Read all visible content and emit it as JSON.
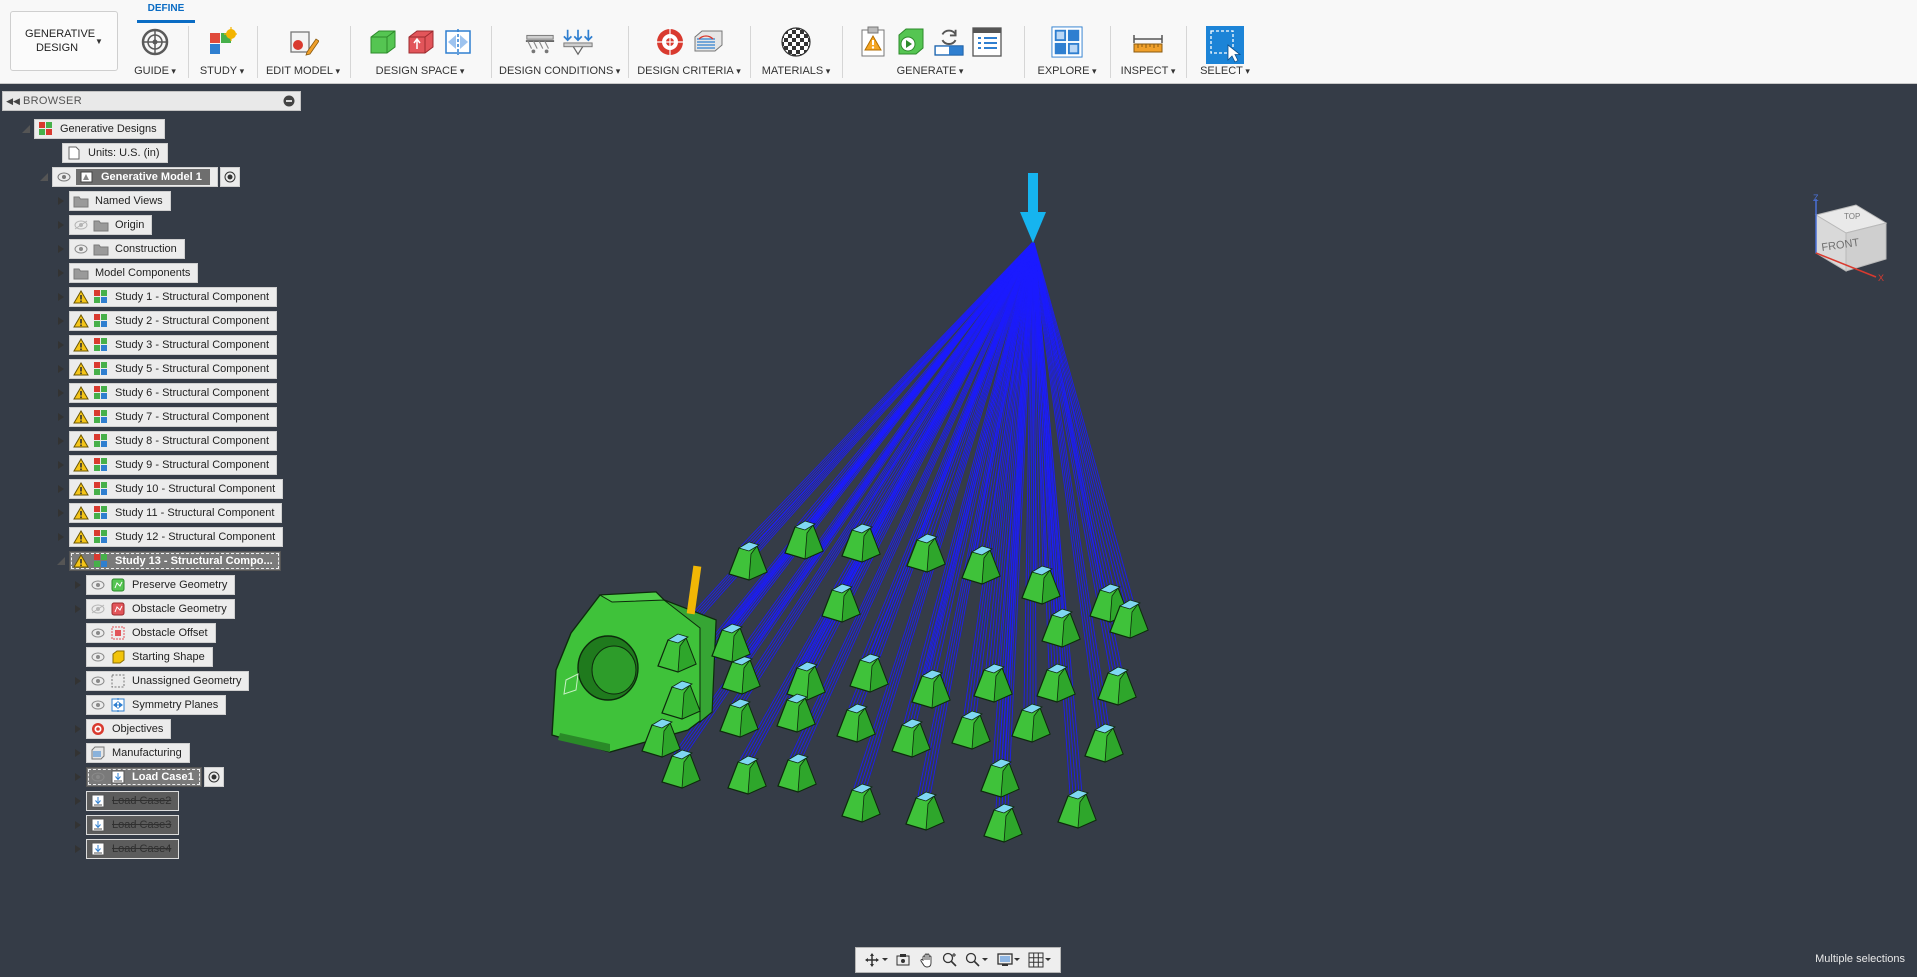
{
  "workspace": {
    "line1": "GENERATIVE",
    "line2": "DESIGN"
  },
  "active_tab": "DEFINE",
  "toolbar_groups": [
    {
      "id": "guide",
      "label": "GUIDE"
    },
    {
      "id": "study",
      "label": "STUDY"
    },
    {
      "id": "edit_model",
      "label": "EDIT MODEL"
    },
    {
      "id": "design_space",
      "label": "DESIGN SPACE"
    },
    {
      "id": "design_conditions",
      "label": "DESIGN CONDITIONS"
    },
    {
      "id": "design_criteria",
      "label": "DESIGN CRITERIA"
    },
    {
      "id": "materials",
      "label": "MATERIALS"
    },
    {
      "id": "generate",
      "label": "GENERATE"
    },
    {
      "id": "explore",
      "label": "EXPLORE"
    },
    {
      "id": "inspect",
      "label": "INSPECT"
    },
    {
      "id": "select",
      "label": "SELECT"
    }
  ],
  "browser": {
    "title": "BROWSER",
    "root": "Generative Designs",
    "units": "Units: U.S. (in)",
    "model": "Generative Model 1",
    "folders": [
      "Named Views",
      "Origin",
      "Construction",
      "Model Components"
    ],
    "studies": [
      "Study 1 - Structural Component",
      "Study 2 - Structural Component",
      "Study 3 - Structural Component",
      "Study 5 - Structural Component",
      "Study 6 - Structural Component",
      "Study 7 - Structural Component",
      "Study 8 - Structural Component",
      "Study 9 - Structural Component",
      "Study 10 - Structural Component",
      "Study 11 - Structural Component",
      "Study 12 - Structural Component"
    ],
    "active_study": "Study 13 - Structural Compo...",
    "study_children": [
      "Preserve Geometry",
      "Obstacle Geometry",
      "Obstacle Offset",
      "Starting Shape",
      "Unassigned Geometry",
      "Symmetry Planes",
      "Objectives",
      "Manufacturing"
    ],
    "load_cases": [
      "Load Case1",
      "Load Case2",
      "Load Case3",
      "Load Case4"
    ]
  },
  "viewcube": {
    "top": "TOP",
    "front": "FRONT",
    "axis_x": "X",
    "axis_z": "Z"
  },
  "status_text": "Multiple selections",
  "colors": {
    "canvas": "#353c47",
    "preserve_green": "#3fc23a",
    "load_arrow": "#16b4ef",
    "load_lines": "#1b1bff",
    "accent": "#0a6cc4",
    "warning": "#f5c518"
  }
}
